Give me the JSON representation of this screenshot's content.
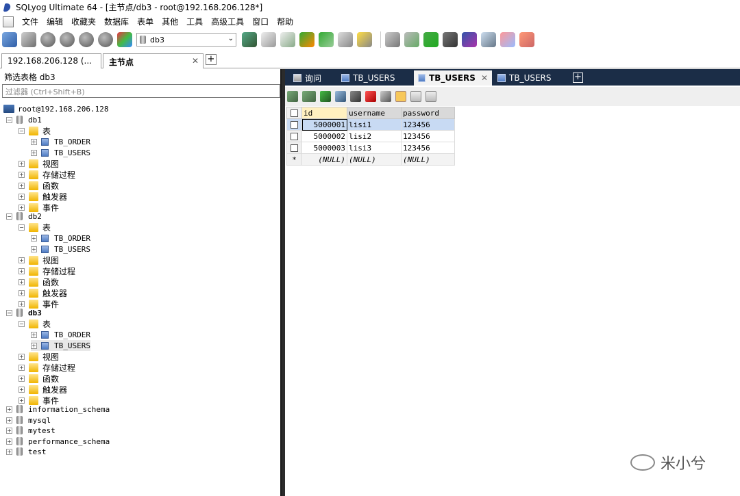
{
  "window": {
    "title": "SQLyog Ultimate 64 - [主节点/db3 - root@192.168.206.128*]"
  },
  "menu": [
    "文件",
    "编辑",
    "收藏夹",
    "数据库",
    "表单",
    "其他",
    "工具",
    "高级工具",
    "窗口",
    "帮助"
  ],
  "toolbar": {
    "db_selected": "db3"
  },
  "connection_tabs": [
    {
      "label": "192.168.206.128 (..."
    },
    {
      "label": "主节点"
    }
  ],
  "left": {
    "filter_header": "筛选表格 db3",
    "filter_placeholder": "过滤器 (Ctrl+Shift+B)"
  },
  "tree": {
    "server": "root@192.168.206.128",
    "db1": {
      "name": "db1",
      "tables": "表",
      "t1": "TB_ORDER",
      "t2": "TB_USERS",
      "views": "视图",
      "procs": "存储过程",
      "funcs": "函数",
      "triggers": "触发器",
      "events": "事件"
    },
    "db2": {
      "name": "db2",
      "tables": "表",
      "t1": "TB_ORDER",
      "t2": "TB_USERS",
      "views": "视图",
      "procs": "存储过程",
      "funcs": "函数",
      "triggers": "触发器",
      "events": "事件"
    },
    "db3": {
      "name": "db3",
      "tables": "表",
      "t1": "TB_ORDER",
      "t2": "TB_USERS",
      "views": "视图",
      "procs": "存储过程",
      "funcs": "函数",
      "triggers": "触发器",
      "events": "事件"
    },
    "others": [
      "information_schema",
      "mysql",
      "mytest",
      "performance_schema",
      "test"
    ]
  },
  "query_tabs": [
    {
      "label": "询问"
    },
    {
      "label": "TB_USERS"
    },
    {
      "label": "TB_USERS"
    },
    {
      "label": "TB_USERS"
    }
  ],
  "grid": {
    "headers": [
      "id",
      "username",
      "password"
    ],
    "rows": [
      [
        "5000001",
        "lisi1",
        "123456"
      ],
      [
        "5000002",
        "lisi2",
        "123456"
      ],
      [
        "5000003",
        "lisi3",
        "123456"
      ]
    ],
    "new_row": [
      "(NULL)",
      "(NULL)",
      "(NULL)"
    ],
    "new_marker": "*"
  },
  "watermark": "米小兮"
}
